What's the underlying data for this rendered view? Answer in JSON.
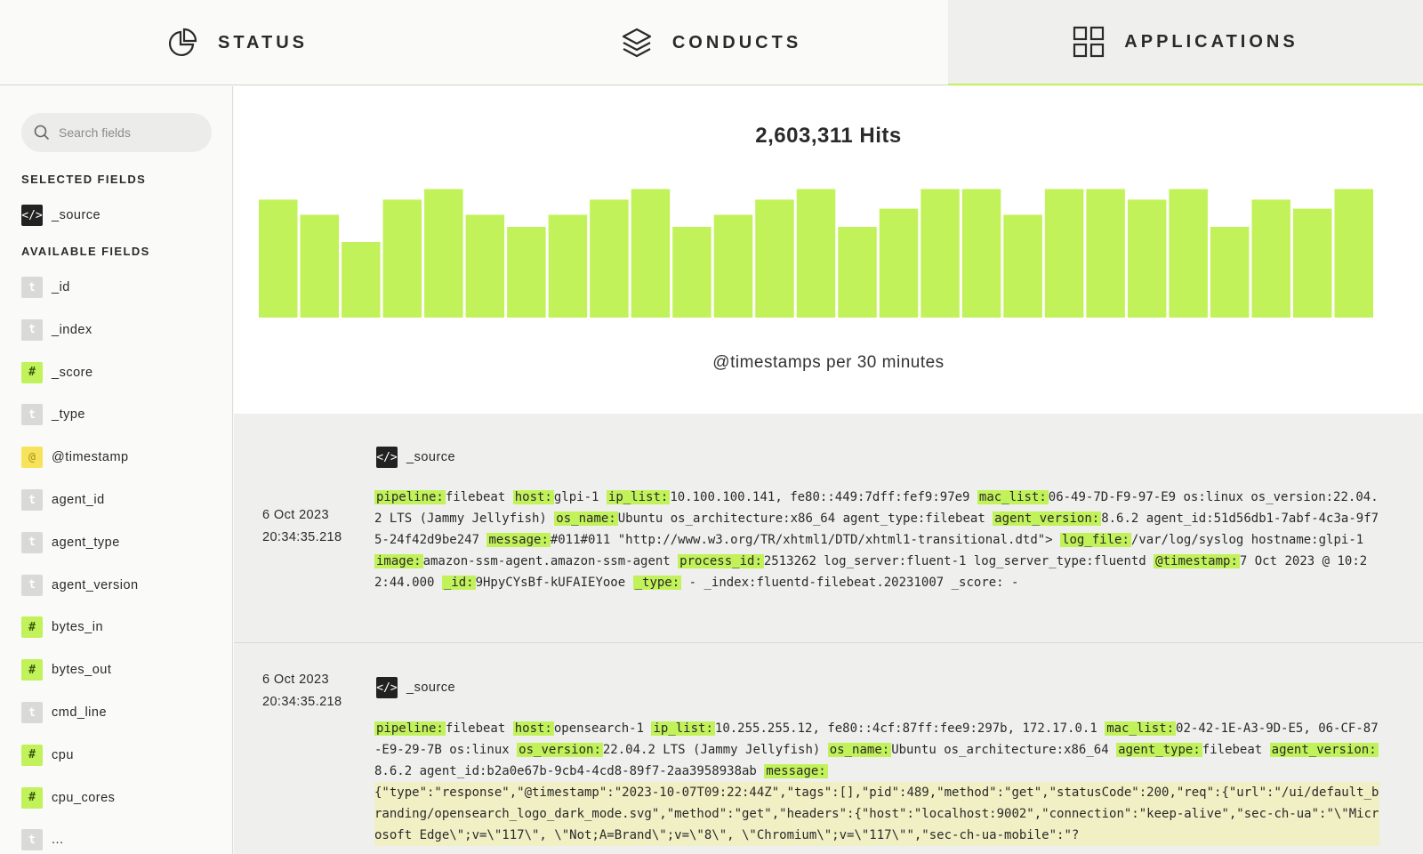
{
  "nav": {
    "tabs": [
      {
        "label": "STATUS",
        "icon": "pie-chart-icon"
      },
      {
        "label": "CONDUCTS",
        "icon": "layers-icon"
      },
      {
        "label": "APPLICATIONS",
        "icon": "grid-icon",
        "active": true
      }
    ]
  },
  "sidebar": {
    "search_placeholder": "Search fields",
    "selected_title": "SELECTED FIELDS",
    "selected": [
      {
        "type": "code",
        "badge": "</>",
        "name": "_source"
      }
    ],
    "available_title": "AVAILABLE FIELDS",
    "available": [
      {
        "type": "t",
        "badge": "t",
        "name": "_id"
      },
      {
        "type": "t",
        "badge": "t",
        "name": "_index"
      },
      {
        "type": "num",
        "badge": "#",
        "name": "_score"
      },
      {
        "type": "t",
        "badge": "t",
        "name": "_type"
      },
      {
        "type": "at",
        "badge": "@",
        "name": "@timestamp"
      },
      {
        "type": "t",
        "badge": "t",
        "name": "agent_id"
      },
      {
        "type": "t",
        "badge": "t",
        "name": "agent_type"
      },
      {
        "type": "t",
        "badge": "t",
        "name": "agent_version"
      },
      {
        "type": "num",
        "badge": "#",
        "name": "bytes_in"
      },
      {
        "type": "num",
        "badge": "#",
        "name": "bytes_out"
      },
      {
        "type": "t",
        "badge": "t",
        "name": "cmd_line"
      },
      {
        "type": "num",
        "badge": "#",
        "name": "cpu"
      },
      {
        "type": "num",
        "badge": "#",
        "name": "cpu_cores"
      },
      {
        "type": "t",
        "badge": "t",
        "name": "..."
      }
    ]
  },
  "hits_label": "2,603,311 Hits",
  "chart_data": {
    "type": "bar",
    "title": "2,603,311 Hits",
    "xlabel": "@timestamps per 30 minutes",
    "ylabel": "",
    "values": [
      78,
      68,
      50,
      78,
      85,
      68,
      60,
      68,
      78,
      85,
      60,
      68,
      78,
      85,
      60,
      72,
      85,
      85,
      68,
      85,
      85,
      78,
      85,
      60,
      78,
      72,
      85
    ],
    "ylim": [
      0,
      100
    ],
    "grid": false,
    "color": "#c2f25a"
  },
  "documents": [
    {
      "date": "6 Oct 2023",
      "time": "20:34:35.218",
      "source_label": "_source",
      "fields": [
        {
          "k": "pipeline:",
          "v": "filebeat "
        },
        {
          "k": "host:",
          "v": "glpi-1 "
        },
        {
          "k": "ip_list:",
          "v": "10.100.100.141, fe80::449:7dff:fef9:97e9 "
        },
        {
          "k": "mac_list:",
          "v": "06-49-7D-F9-97-E9 os:linux os_version:22.04.2 LTS (Jammy Jellyfish) "
        },
        {
          "k": "os_name:",
          "v": "Ubuntu os_architecture:x86_64 agent_type:filebeat "
        },
        {
          "k": "agent_version:",
          "v": "8.6.2 agent_id:51d56db1-7abf-4c3a-9f75-24f42d9be247 "
        },
        {
          "k": "message:",
          "v": "#011#011 \"http://www.w3.org/TR/xhtml1/DTD/xhtml1-transitional.dtd\"> "
        },
        {
          "k": "log_file:",
          "v": "/var/log/syslog hostname:glpi-1 "
        },
        {
          "k": "image:",
          "v": "amazon-ssm-agent.amazon-ssm-agent "
        },
        {
          "k": "process_id:",
          "v": "2513262 log_server:fluent-1 log_server_type:fluentd "
        },
        {
          "k": "@timestamp:",
          "v": "7 Oct 2023 @ 10:22:44.000 "
        },
        {
          "k": "_id:",
          "v": "9HpyCYsBf-kUFAIEYooe "
        },
        {
          "k": "_type:",
          "v": " - _index:fluentd-filebeat.20231007 _score: -"
        }
      ]
    },
    {
      "date": "6 Oct 2023",
      "time": "20:34:35.218",
      "source_label": "_source",
      "fields": [
        {
          "k": "pipeline:",
          "v": "filebeat "
        },
        {
          "k": "host:",
          "v": "opensearch-1 "
        },
        {
          "k": "ip_list:",
          "v": "10.255.255.12, fe80::4cf:87ff:fee9:297b, 172.17.0.1 "
        },
        {
          "k": "mac_list:",
          "v": "02-42-1E-A3-9D-E5, 06-CF-87-E9-29-7B os:linux "
        },
        {
          "k": "os_version:",
          "v": "22.04.2 LTS (Jammy Jellyfish) "
        },
        {
          "k": "os_name:",
          "v": "Ubuntu os_architecture:x86_64 "
        },
        {
          "k": "agent_type:",
          "v": "filebeat "
        },
        {
          "k": "agent_version:",
          "v": "8.6.2 agent_id:b2a0e67b-9cb4-4cd8-89f7-2aa3958938ab "
        },
        {
          "k": "message:",
          "v": ""
        }
      ],
      "message_text": "{\"type\":\"response\",\"@timestamp\":\"2023-10-07T09:22:44Z\",\"tags\":[],\"pid\":489,\"method\":\"get\",\"statusCode\":200,\"req\":{\"url\":\"/ui/default_branding/opensearch_logo_dark_mode.svg\",\"method\":\"get\",\"headers\":{\"host\":\"localhost:9002\",\"connection\":\"keep-alive\",\"sec-ch-ua\":\"\\\"Microsoft Edge\\\";v=\\\"117\\\", \\\"Not;A=Brand\\\";v=\\\"8\\\", \\\"Chromium\\\";v=\\\"117\\\"\",\"sec-ch-ua-mobile\":\"?"
    }
  ]
}
